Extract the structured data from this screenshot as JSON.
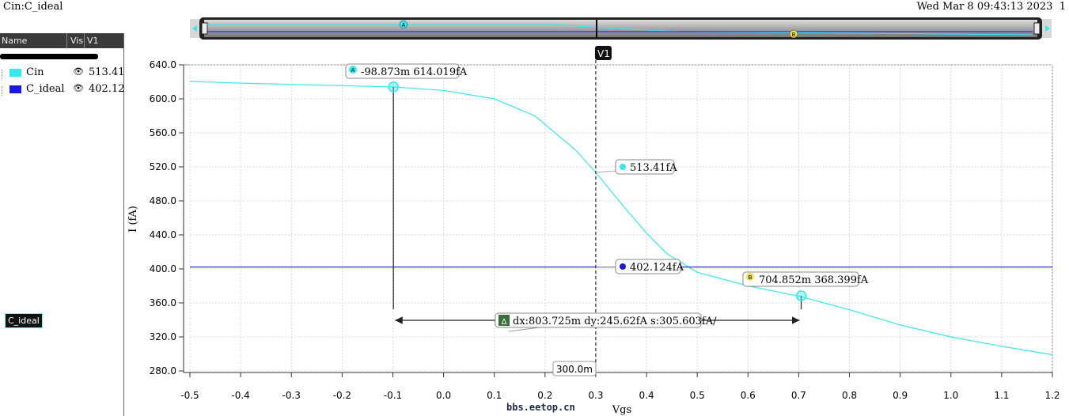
{
  "window": {
    "title": "Cin:C_ideal",
    "date": "Wed Mar 8 09:43:13 2023",
    "page": "1"
  },
  "legend_panel": {
    "headers": {
      "name": "Name",
      "vis": "Vis",
      "v1": "V1"
    },
    "items": [
      {
        "name": "Cin",
        "value": "513.41",
        "color": "#33e8ee"
      },
      {
        "name": "C_ideal",
        "value": "402.12",
        "color": "#1a1ae0"
      }
    ],
    "selected_tag": "C_ideal"
  },
  "navigator": {
    "marker_a": "A",
    "marker_b": "B"
  },
  "cursor": {
    "label": "V1",
    "x_readout": "300.0m"
  },
  "markers": {
    "a": {
      "letter": "A",
      "label": "-98.873m 614.019fA"
    },
    "b": {
      "letter": "B",
      "label": "704.852m 368.399fA"
    },
    "cin_at_cursor": "513.41fA",
    "ideal_at_cursor": "402.124fA",
    "delta": {
      "symbol": "Δ",
      "label": "dx:803.725m dy:245.62fA s:305.603fA/"
    }
  },
  "watermark": "bbs.eetop.cn",
  "chart_data": {
    "type": "line",
    "xlabel": "Vgs",
    "ylabel": "I (fA)",
    "xlim": [
      -0.5,
      1.2
    ],
    "ylim": [
      280,
      640
    ],
    "x_ticks": [
      "-0.5",
      "-0.4",
      "-0.3",
      "-0.2",
      "-0.1",
      "0.0",
      "0.1",
      "0.2",
      "0.3",
      "0.4",
      "0.5",
      "0.6",
      "0.7",
      "0.8",
      "0.9",
      "1.0",
      "1.1",
      "1.2"
    ],
    "y_ticks": [
      "280.0",
      "320.0",
      "360.0",
      "400.0",
      "440.0",
      "480.0",
      "520.0",
      "560.0",
      "600.0",
      "640.0"
    ],
    "grid": true,
    "series": [
      {
        "name": "Cin",
        "color": "#33e8ee",
        "x": [
          -0.5,
          -0.4,
          -0.3,
          -0.2,
          -0.1,
          0.0,
          0.1,
          0.18,
          0.26,
          0.3,
          0.35,
          0.4,
          0.44,
          0.5,
          0.6,
          0.7,
          0.8,
          0.9,
          1.0,
          1.1,
          1.2
        ],
        "y": [
          620.5,
          618.5,
          617,
          615.5,
          614,
          610,
          600,
          580,
          540,
          513.4,
          477,
          442,
          418,
          396,
          380,
          368,
          352,
          334,
          320,
          309,
          299
        ]
      },
      {
        "name": "C_ideal",
        "color": "#1a1ae0",
        "x": [
          -0.5,
          1.2
        ],
        "y": [
          402.124,
          402.124
        ]
      }
    ]
  }
}
